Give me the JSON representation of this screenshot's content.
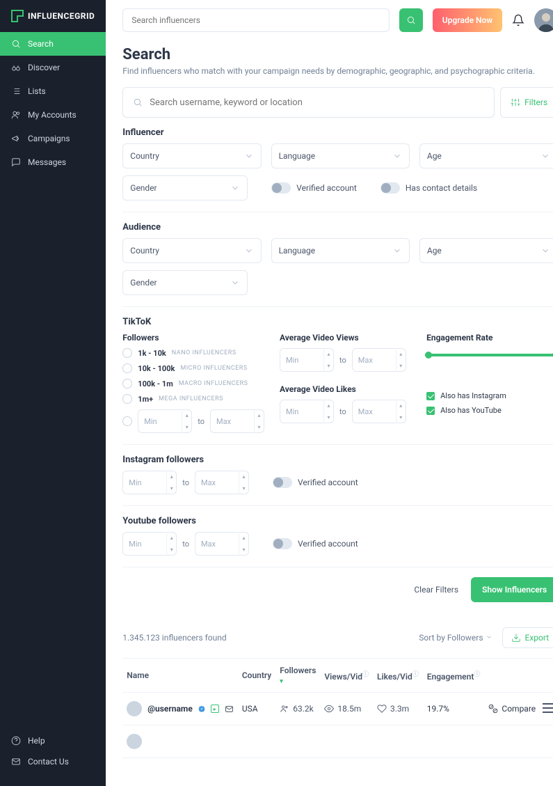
{
  "brand": "INFLUENCEGRID",
  "sidebar": {
    "items": [
      {
        "label": "Search",
        "active": true,
        "name": "sidebar-item-search"
      },
      {
        "label": "Discover",
        "name": "sidebar-item-discover"
      },
      {
        "label": "Lists",
        "name": "sidebar-item-lists"
      },
      {
        "label": "My Accounts",
        "name": "sidebar-item-my-accounts"
      },
      {
        "label": "Campaigns",
        "name": "sidebar-item-campaigns"
      },
      {
        "label": "Messages",
        "name": "sidebar-item-messages"
      }
    ],
    "footer": [
      {
        "label": "Help",
        "name": "sidebar-item-help"
      },
      {
        "label": "Contact Us",
        "name": "sidebar-item-contact"
      }
    ]
  },
  "top": {
    "search_placeholder": "Search influencers",
    "upgrade": "Upgrade Now"
  },
  "page": {
    "title": "Search",
    "subtitle": "Find influencers who match with your campaign needs by demographic, geographic, and psychographic criteria.",
    "filter_placeholder": "Search username, keyword or location",
    "filters_btn": "Filters"
  },
  "influencer": {
    "title": "Influencer",
    "country": "Country",
    "language": "Language",
    "age": "Age",
    "gender": "Gender",
    "verified": "Verified account",
    "contact": "Has contact details"
  },
  "audience": {
    "title": "Audience",
    "country": "Country",
    "language": "Language",
    "age": "Age",
    "gender": "Gender"
  },
  "tiktok": {
    "title": "TikToK",
    "followers": "Followers",
    "ranges": [
      {
        "label": "1k - 10k",
        "tag": "NANO INFLUENCERS"
      },
      {
        "label": "10k - 100k",
        "tag": "MICRO INFLUENCERS"
      },
      {
        "label": "100k - 1m",
        "tag": "MACRO INFLUENCERS"
      },
      {
        "label": "1m+",
        "tag": "MEGA INFLUENCERS"
      }
    ],
    "min": "Min",
    "max": "Max",
    "to": "to",
    "avg_views": "Average Video Views",
    "avg_likes": "Average Video Likes",
    "engagement": "Engagement Rate",
    "has_instagram": "Also has Instagram",
    "has_youtube": "Also has YouTube"
  },
  "instagram": {
    "title": "Instagram followers",
    "min": "Min",
    "max": "Max",
    "to": "to",
    "verified": "Verified account"
  },
  "youtube": {
    "title": "Youtube followers",
    "min": "Min",
    "max": "Max",
    "to": "to",
    "verified": "Verified account"
  },
  "actions": {
    "clear": "Clear Filters",
    "show": "Show Influencers"
  },
  "results": {
    "count": "1.345.123 influencers found",
    "sort": "Sort by Followers",
    "export": "Export",
    "cols": {
      "name": "Name",
      "country": "Country",
      "followers": "Followers",
      "views": "Views/Vid",
      "likes": "Likes/Vid",
      "engagement": "Engagement"
    },
    "rows": [
      {
        "username": "@username",
        "country": "USA",
        "followers": "63.2k",
        "views": "18.5m",
        "likes": "3.3m",
        "engagement": "19.7%",
        "compare": "Compare"
      }
    ]
  }
}
